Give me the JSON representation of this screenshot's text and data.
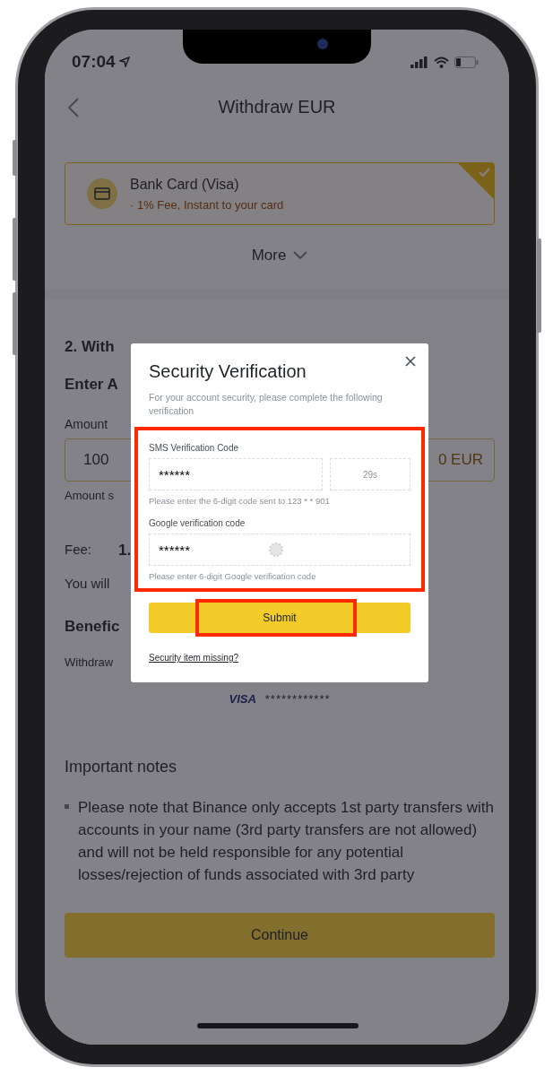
{
  "status_bar": {
    "time": "07:04"
  },
  "header": {
    "title": "Withdraw EUR"
  },
  "method_card": {
    "title": "Bank Card (Visa)",
    "subtitle": "· 1% Fee, Instant to your card",
    "selected": true
  },
  "more_link": "More",
  "section": {
    "heading": "2. With",
    "subheading": "Enter A",
    "amount_label": "Amount",
    "amount_value": "100",
    "amount_suffix": "0 EUR",
    "amount_hint": "Amount s",
    "fee_label": "Fee:",
    "fee_value": "1.",
    "receive_text": "You will",
    "beneficiary_heading": "Benefic",
    "withdraw_to_label": "Withdraw",
    "card_brand": "VISA",
    "card_number": "************"
  },
  "notes": {
    "heading": "Important notes",
    "items": [
      "Please note that Binance only accepts 1st party transfers with accounts in your name (3rd party transfers are not allowed) and will not be held responsible for any potential losses/rejection of funds associated with 3rd party"
    ]
  },
  "continue_button": "Continue",
  "dialog": {
    "title": "Security Verification",
    "description": "For your account security, please complete the following verification",
    "fields_highlighted": true,
    "fields": [
      {
        "kind": "sms",
        "label": "SMS Verification Code",
        "value": "******",
        "timer": "29s",
        "hint": "Please enter the 6-digit code sent to 123 * * 901",
        "loading": false
      },
      {
        "kind": "code",
        "label": "Google verification code",
        "value": "******",
        "hint": "Please enter 6-digit Google verification code",
        "loading": true
      }
    ],
    "submit": {
      "label": "Submit",
      "highlighted": true
    },
    "link": "Security item missing?"
  }
}
